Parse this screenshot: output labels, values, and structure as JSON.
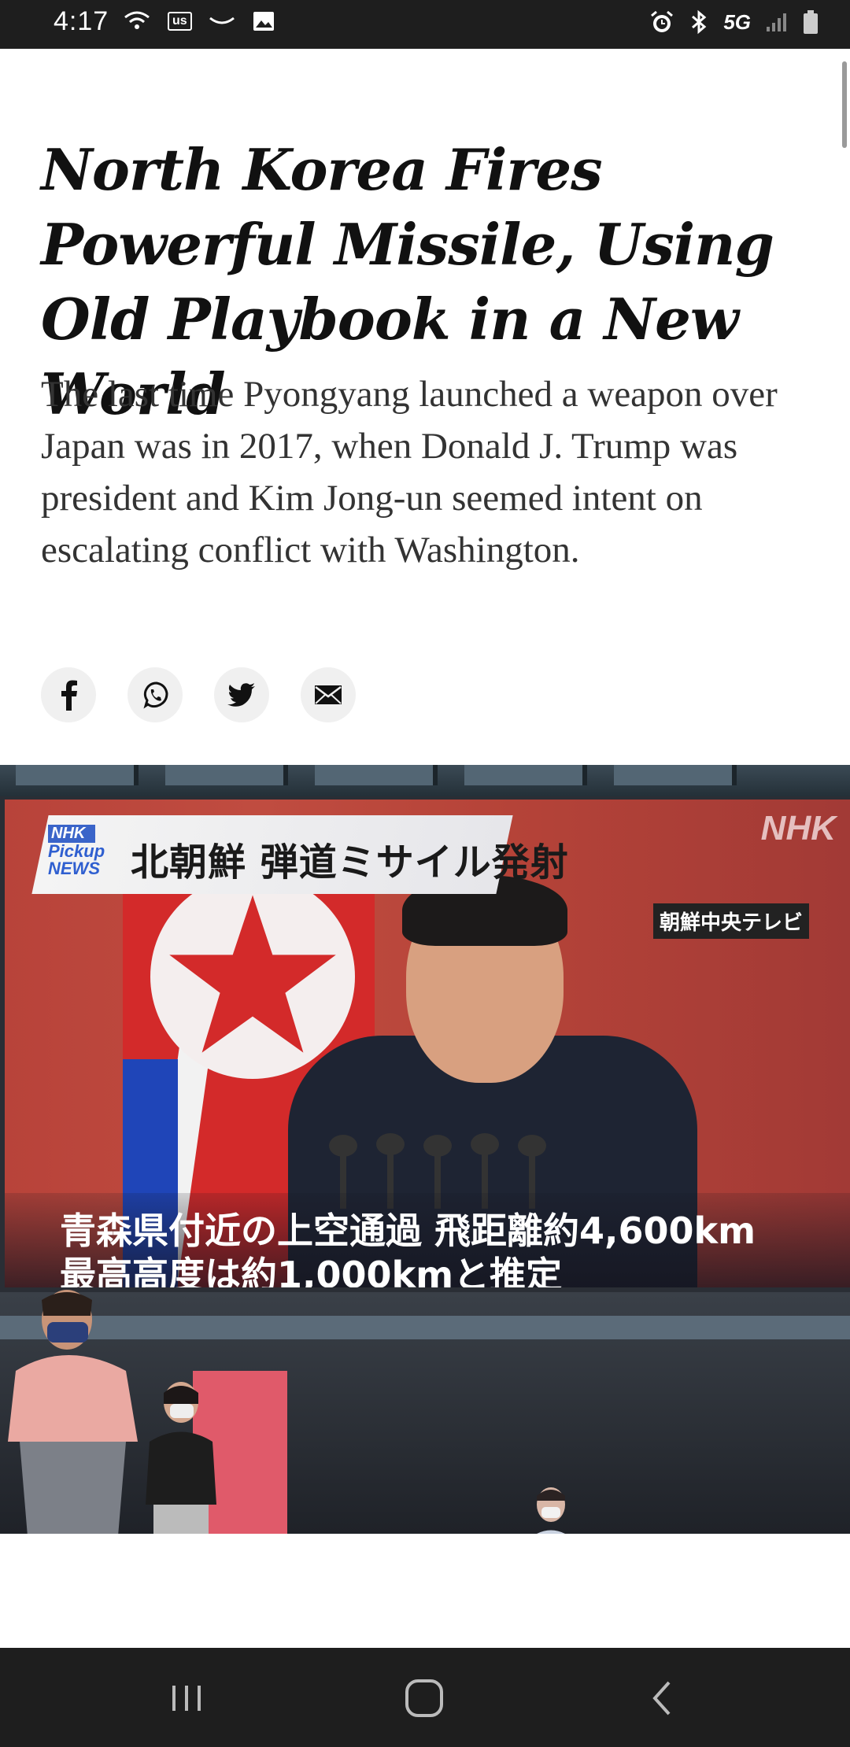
{
  "status_bar": {
    "time": "4:17",
    "carrier_badge": "us",
    "network": "5G"
  },
  "article": {
    "headline": "North Korea Fires Powerful Missile, Using Old Playbook in a New World",
    "summary": "The last time Pyongyang launched a weapon over Japan was in 2017, when Donald J. Trump was president and Kim Jong-un seemed intent on escalating conflict with Washington."
  },
  "share": {
    "buttons": [
      "facebook-icon",
      "whatsapp-icon",
      "twitter-icon",
      "email-icon"
    ]
  },
  "photo": {
    "banner_small_1": "NHK",
    "banner_small_2": "Pickup",
    "banner_small_3": "NEWS",
    "banner_title": "北朝鮮 弾道ミサイル発射",
    "logo": "NHK",
    "source_tag": "朝鮮中央テレビ",
    "caption_line_1": "青森県付近の上空通過 飛距離約4,600km",
    "caption_line_2": "最高高度は約1,000kmと推定"
  },
  "nav_bar": {
    "buttons": [
      "recent-apps-icon",
      "home-icon",
      "back-icon"
    ]
  }
}
